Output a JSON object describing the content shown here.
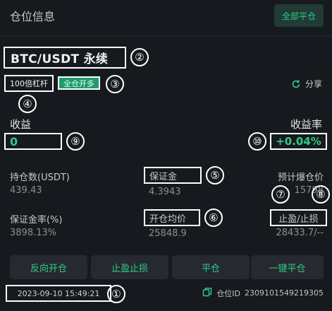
{
  "header": {
    "title": "仓位信息",
    "close_all_label": "全部平仓"
  },
  "position": {
    "pair": "BTC/USDT 永续",
    "leverage": "100倍杠杆",
    "margin_mode": "全仓开多",
    "share_label": "分享"
  },
  "pnl": {
    "label": "收益",
    "value": "0"
  },
  "roe": {
    "label": "收益率",
    "value": "+0.04%"
  },
  "stats": {
    "holding_label": "持仓数(USDT)",
    "holding_value": "439.43",
    "margin_label": "保证金",
    "margin_value": "4.3943",
    "liq_label": "预计爆仓价",
    "liq_value": "15798",
    "margin_ratio_label": "保证金率(%)",
    "margin_ratio_value": "3898.13%",
    "avg_price_label": "开仓均价",
    "avg_price_value": "25848.9",
    "tpsl_label": "止盈/止损",
    "tpsl_value": "28433.7/--"
  },
  "actions": {
    "reverse": "反向开仓",
    "tpsl": "止盈止损",
    "close": "平仓",
    "close_one_click": "一键平仓"
  },
  "footer": {
    "timestamp": "2023-09-10 15:49:21",
    "position_id_label": "仓位ID",
    "position_id": "2309101549219305"
  },
  "annotations": [
    "①",
    "②",
    "③",
    "④",
    "⑤",
    "⑥",
    "⑦",
    "⑧",
    "⑨",
    "⑩"
  ],
  "colors": {
    "background": "#16191d",
    "accent_green": "#2ecc8c",
    "button_bg": "#262a30",
    "annotation": "#ffffff"
  },
  "icons": {
    "share": "share-refresh-icon",
    "copy": "copy-icon"
  }
}
